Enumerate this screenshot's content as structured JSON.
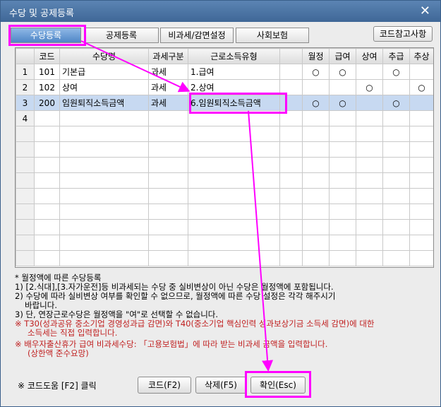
{
  "window": {
    "title": "수당 및 공제등록",
    "close_glyph": "✕"
  },
  "tabs": [
    {
      "label": "수당등록",
      "active": true
    },
    {
      "label": "공제등록",
      "active": false
    },
    {
      "label": "비과세/감면설정",
      "active": false
    },
    {
      "label": "사회보험",
      "active": false
    }
  ],
  "ref_button": "코드참고사항",
  "table": {
    "headers": [
      "",
      "코드",
      "수당명",
      "과세구분",
      "근로소득유형",
      "",
      "월정",
      "급여",
      "상여",
      "추급",
      "추상"
    ],
    "rows": [
      {
        "num": "1",
        "code": "101",
        "name": "기본급",
        "tax": "과세",
        "type": "1.급여",
        "m": "○",
        "g": "○",
        "s": "",
        "cg": "○",
        "cs": ""
      },
      {
        "num": "2",
        "code": "102",
        "name": "상여",
        "tax": "과세",
        "type": "2.상여",
        "m": "",
        "g": "",
        "s": "○",
        "cg": "",
        "cs": "○"
      },
      {
        "num": "3",
        "code": "200",
        "name": "임원퇴직소득금액",
        "tax": "과세",
        "type": "6.임원퇴직소득금액",
        "m": "○",
        "g": "○",
        "s": "",
        "cg": "○",
        "cs": ""
      },
      {
        "num": "4",
        "code": "",
        "name": "",
        "tax": "",
        "type": "",
        "m": "",
        "g": "",
        "s": "",
        "cg": "",
        "cs": ""
      }
    ],
    "empty_rows": 9
  },
  "notes": {
    "heading": "* 월정액에 따른 수당등록",
    "n1": "1) [2.식대],[3.자가운전]등 비과세되는 수당 중 실비변상이 아닌 수당은 월정액에 포함됩니다.",
    "n2a": "2) 수당에 따라 실비변상 여부를 확인할 수 없으므로, 월정액에 따른 수당 설정은 각각 해주시기",
    "n2b": "바랍니다.",
    "n3": "3) 단, 연장근로수당은 월정액을 \"여\"로 선택할 수 없습니다.",
    "r1a": "※ T30(성과공유 중소기업 경영성과급 감면)와 T40(중소기업 핵심인력 성과보상기금 소득세 감면)에 대한",
    "r1b": "소득세는 직접 입력합니다.",
    "r2a": "※ 배우자출산휴가 급여 비과세수당: 「고용보험법」에 따라 받는 비과세 금액을 입력합니다.",
    "r2b": "(상한액 준수요망)"
  },
  "footer": {
    "hint": "※ 코드도움 [F2] 클릭",
    "code_button": "코드(F2)",
    "delete_button": "삭제(F5)",
    "confirm_button": "확인(Esc)"
  },
  "colors": {
    "highlight": "#ff00ff",
    "title_bar": "#4a74a5",
    "selected_row": "#c7d9f1",
    "note_red": "#c02020"
  }
}
